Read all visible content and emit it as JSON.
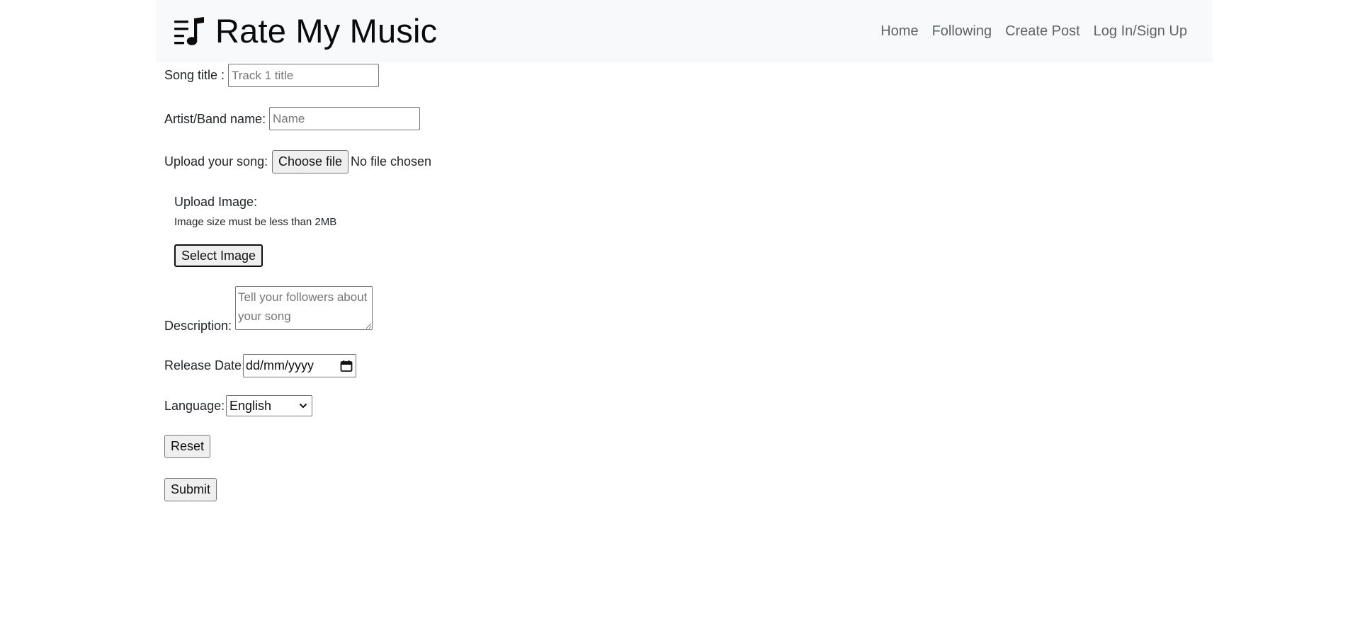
{
  "navbar": {
    "brand_text": "Rate My Music",
    "brand_icon": "music-playlist-icon",
    "links": [
      {
        "label": "Home"
      },
      {
        "label": "Following"
      },
      {
        "label": "Create Post"
      },
      {
        "label": "Log In/Sign Up"
      }
    ]
  },
  "form": {
    "song_title": {
      "label": "Song title :",
      "placeholder": "Track 1 title",
      "value": ""
    },
    "artist": {
      "label": "Artist/Band name:",
      "placeholder": "Name",
      "value": ""
    },
    "upload_song": {
      "label": "Upload your song:",
      "button_label": "Choose file",
      "status": "No file chosen"
    },
    "upload_image": {
      "label": "Upload Image:",
      "note": "Image size must be less than 2MB",
      "button_label": "Select Image"
    },
    "description": {
      "label": "Description:",
      "placeholder": "Tell your followers about your song",
      "value": ""
    },
    "release_date": {
      "label": "Release Date:",
      "placeholder": "dd/mm/yyyy",
      "icon": "calendar-icon"
    },
    "language": {
      "label": "Language:",
      "selected": "English",
      "icon": "chevron-down-icon"
    },
    "reset_label": "Reset",
    "submit_label": "Submit"
  }
}
